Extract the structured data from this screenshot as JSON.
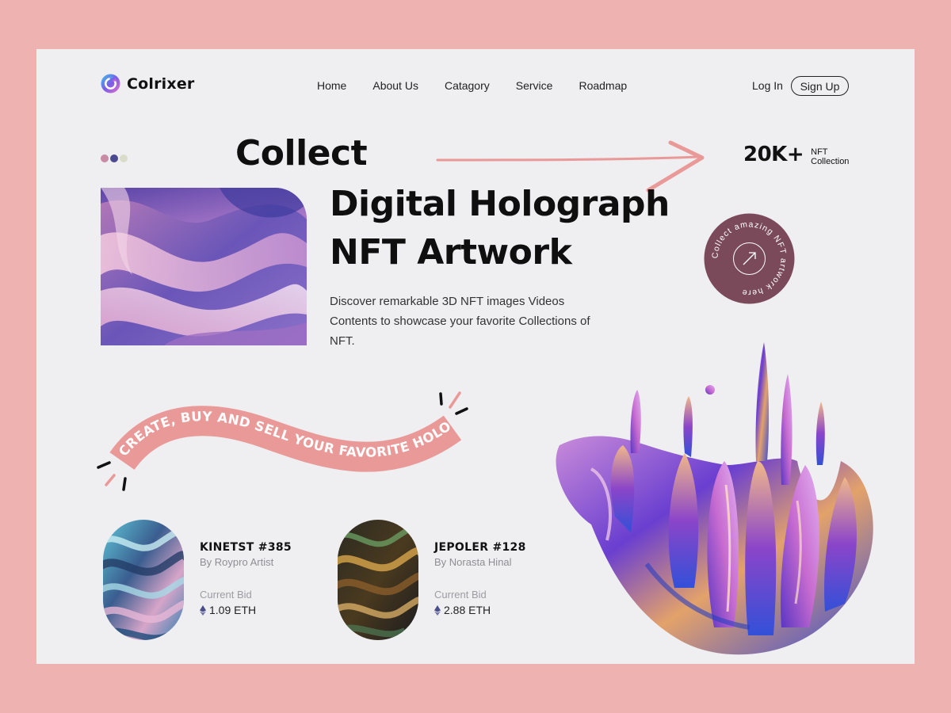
{
  "brand": {
    "name": "Colrixer"
  },
  "nav": {
    "items": [
      {
        "label": "Home"
      },
      {
        "label": "About Us"
      },
      {
        "label": "Catagory"
      },
      {
        "label": "Service"
      },
      {
        "label": "Roadmap"
      }
    ]
  },
  "auth": {
    "login_label": "Log In",
    "signup_label": "Sign Up"
  },
  "hero": {
    "word1": "Collect",
    "line1": "Digital Holograph",
    "line2": "NFT Artwork",
    "description": "Discover remarkable 3D NFT images Videos Contents to showcase your favorite Collections of NFT."
  },
  "stat": {
    "value": "20K+",
    "label_line1": "NFT",
    "label_line2": "Collection"
  },
  "badge": {
    "circular_text": "Collect amazing NFT artwork here"
  },
  "banner": {
    "text": "CREATE, BUY AND SELL YOUR FAVORITE HOLOGRAPH"
  },
  "cards": [
    {
      "name": "KINETST #385",
      "author": "By Roypro Artist",
      "bid_label": "Current Bid",
      "price": "1.09 ETH"
    },
    {
      "name": "JEPOLER #128",
      "author": "By Norasta Hinal",
      "bid_label": "Current Bid",
      "price": "2.88 ETH"
    }
  ],
  "colors": {
    "page_bg": "#eeb3b1",
    "frame_bg": "#efeef1",
    "accent_pink": "#e99a98",
    "badge_bg": "#7a4a5a",
    "dot_colors": [
      "#c98aa4",
      "#4b4a8f",
      "#d9dcc9"
    ]
  },
  "icons": [
    "logo-icon",
    "arrow-icon",
    "up-right-arrow-icon",
    "ethereum-icon"
  ]
}
